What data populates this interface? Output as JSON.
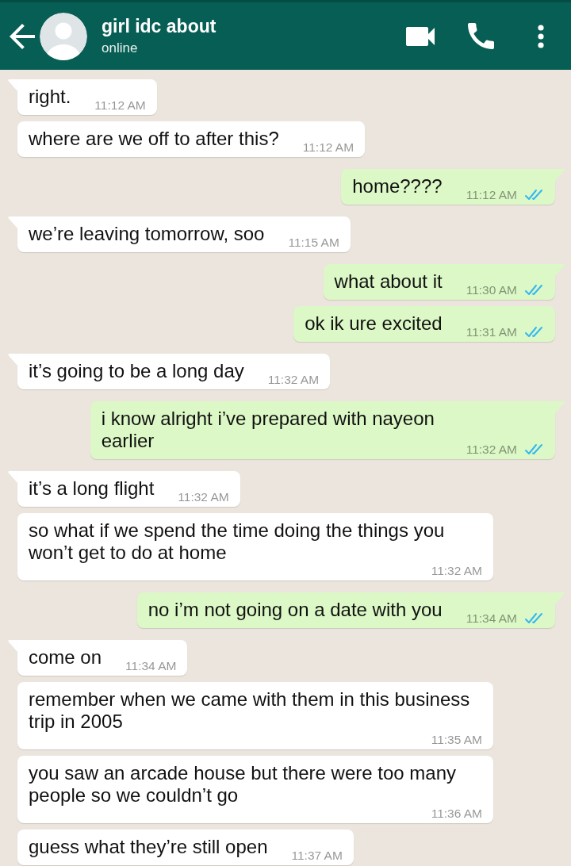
{
  "header": {
    "title": "girl idc about",
    "status": "online"
  },
  "messages": [
    {
      "kind": "incoming",
      "text": "right.",
      "time": "11:12 AM"
    },
    {
      "kind": "incoming",
      "text": "where are we off to after this?",
      "time": "11:12 AM"
    },
    {
      "kind": "outgoing",
      "text": "home????",
      "time": "11:12 AM",
      "read": true
    },
    {
      "kind": "incoming",
      "text": "we’re leaving tomorrow, soo",
      "time": "11:15 AM"
    },
    {
      "kind": "outgoing",
      "text": "what about it",
      "time": "11:30 AM",
      "read": true
    },
    {
      "kind": "outgoing",
      "text": "ok ik ure excited",
      "time": "11:31 AM",
      "read": true
    },
    {
      "kind": "incoming",
      "text": "it’s going to be a long day",
      "time": "11:32 AM"
    },
    {
      "kind": "outgoing",
      "text": "i know alright i’ve prepared with nayeon earlier",
      "time": "11:32 AM",
      "read": true
    },
    {
      "kind": "incoming",
      "text": "it’s a long flight",
      "time": "11:32 AM"
    },
    {
      "kind": "incoming",
      "text": "so what if we spend the time doing the things you won’t get to do at home",
      "time": "11:32 AM"
    },
    {
      "kind": "outgoing",
      "text": "no i’m not going on a date with you",
      "time": "11:34 AM",
      "read": true
    },
    {
      "kind": "incoming",
      "text": "come on",
      "time": "11:34 AM"
    },
    {
      "kind": "incoming",
      "text": "remember when we came with them in this business trip in 2005",
      "time": "11:35 AM"
    },
    {
      "kind": "incoming",
      "text": "you saw an arcade house but there were too many people so we couldn’t go",
      "time": "11:36 AM"
    },
    {
      "kind": "incoming",
      "text": "guess what they’re still open",
      "time": "11:37 AM"
    }
  ]
}
